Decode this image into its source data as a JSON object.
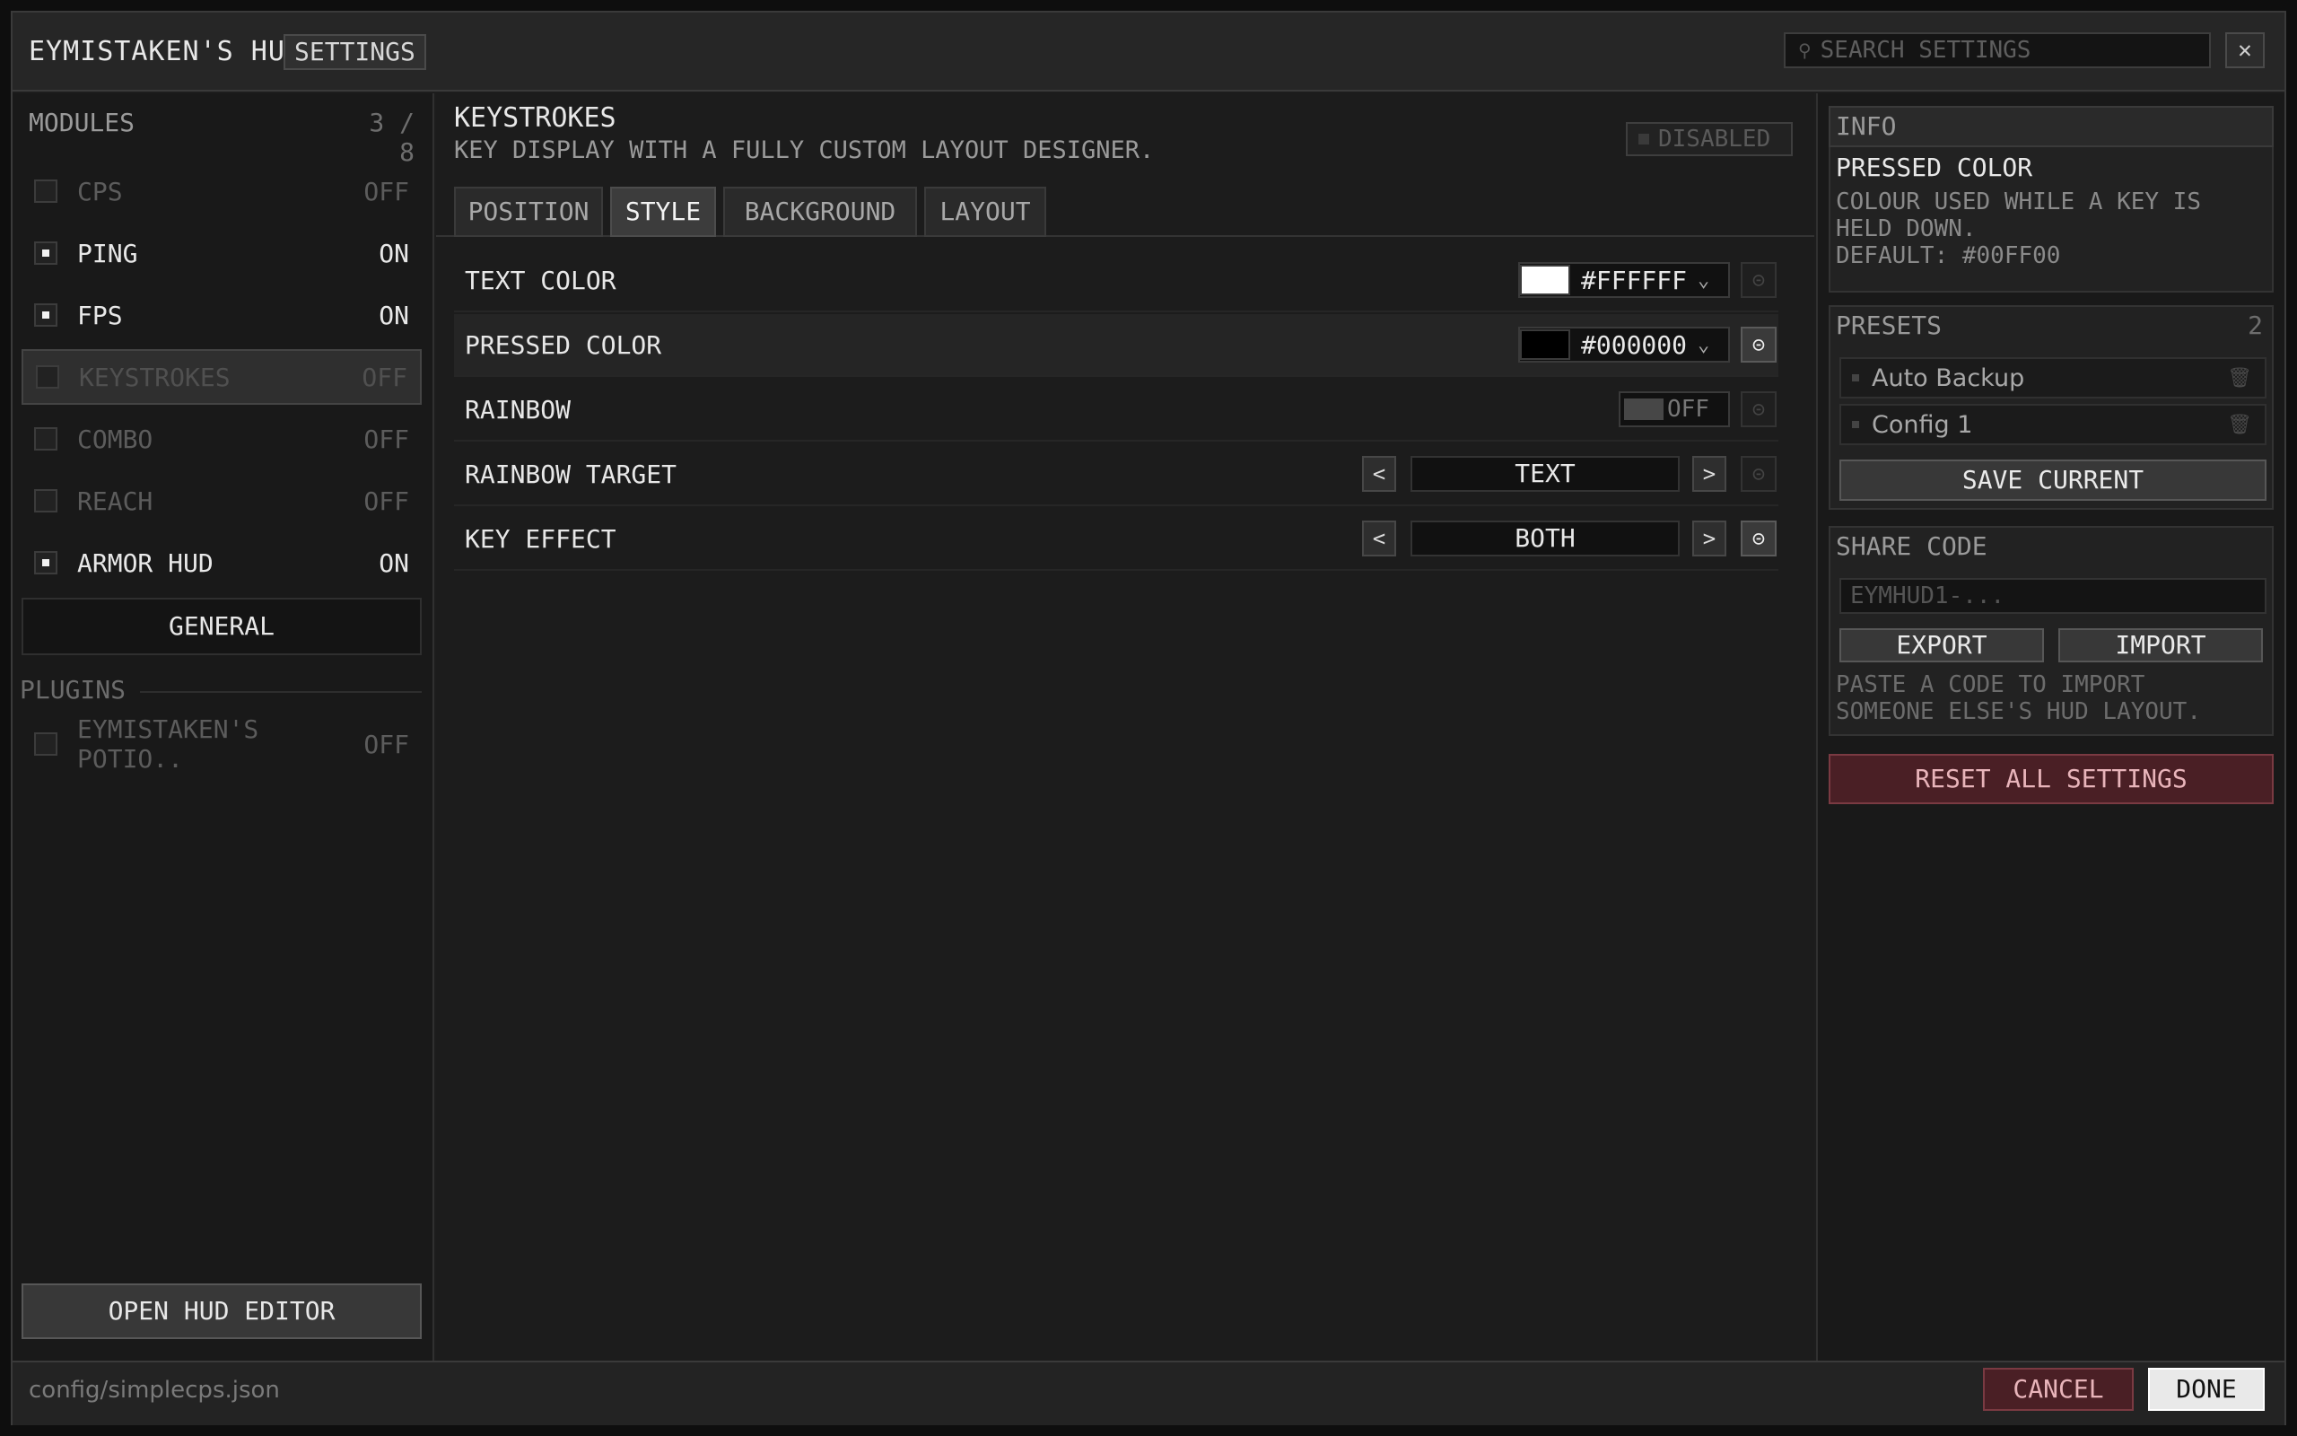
{
  "header": {
    "title": "EYMISTAKEN'S HUD",
    "badge": "SETTINGS",
    "search_placeholder": "SEARCH SETTINGS",
    "close_glyph": "✕"
  },
  "modules": {
    "heading": "MODULES",
    "count": "3 / 8",
    "items": [
      {
        "name": "CPS",
        "state": "OFF",
        "on": false
      },
      {
        "name": "PING",
        "state": "ON",
        "on": true
      },
      {
        "name": "FPS",
        "state": "ON",
        "on": true
      },
      {
        "name": "KEYSTROKES",
        "state": "OFF",
        "on": false,
        "selected": true
      },
      {
        "name": "COMBO",
        "state": "OFF",
        "on": false
      },
      {
        "name": "REACH",
        "state": "OFF",
        "on": false
      },
      {
        "name": "ARMOR HUD",
        "state": "ON",
        "on": true
      }
    ],
    "general_label": "GENERAL",
    "plugins_heading": "PLUGINS",
    "plugins": [
      {
        "name": "EYMISTAKEN'S POTIO..",
        "state": "OFF",
        "on": false
      }
    ],
    "open_editor_label": "OPEN HUD EDITOR"
  },
  "module_detail": {
    "title": "KEYSTROKES",
    "description": "KEY DISPLAY WITH A FULLY CUSTOM LAYOUT DESIGNER.",
    "status_badge": "DISABLED",
    "tabs": [
      {
        "label": "POSITION",
        "active": false
      },
      {
        "label": "STYLE",
        "active": true
      },
      {
        "label": "BACKGROUND",
        "active": false
      },
      {
        "label": "LAYOUT",
        "active": false
      }
    ],
    "settings": {
      "text_color": {
        "label": "TEXT COLOR",
        "value": "#FFFFFF",
        "swatch": "#ffffff"
      },
      "pressed_color": {
        "label": "PRESSED COLOR",
        "value": "#000000",
        "swatch": "#000000"
      },
      "rainbow": {
        "label": "RAINBOW",
        "value": "OFF"
      },
      "rainbow_target": {
        "label": "RAINBOW TARGET",
        "value": "TEXT"
      },
      "key_effect": {
        "label": "KEY EFFECT",
        "value": "BOTH"
      }
    }
  },
  "info": {
    "heading": "INFO",
    "title": "PRESSED COLOR",
    "line1": "COLOUR USED WHILE A KEY IS",
    "line2": "HELD DOWN.",
    "default": "DEFAULT: #00FF00"
  },
  "presets": {
    "heading": "PRESETS",
    "count": "2",
    "items": [
      "Auto Backup",
      "Config 1"
    ],
    "save_label": "SAVE CURRENT"
  },
  "share": {
    "heading": "SHARE CODE",
    "placeholder": "EYMHUD1-...",
    "export_label": "EXPORT",
    "import_label": "IMPORT",
    "hint1": "PASTE A CODE TO IMPORT",
    "hint2": "SOMEONE ELSE'S HUD LAYOUT."
  },
  "reset_all_label": "RESET ALL SETTINGS",
  "footer": {
    "path": "config/simplecps.json",
    "cancel_label": "CANCEL",
    "done_label": "DONE"
  },
  "colors": {
    "accent_danger": "#4a1f25",
    "panel_bg": "#1d1d1d"
  }
}
